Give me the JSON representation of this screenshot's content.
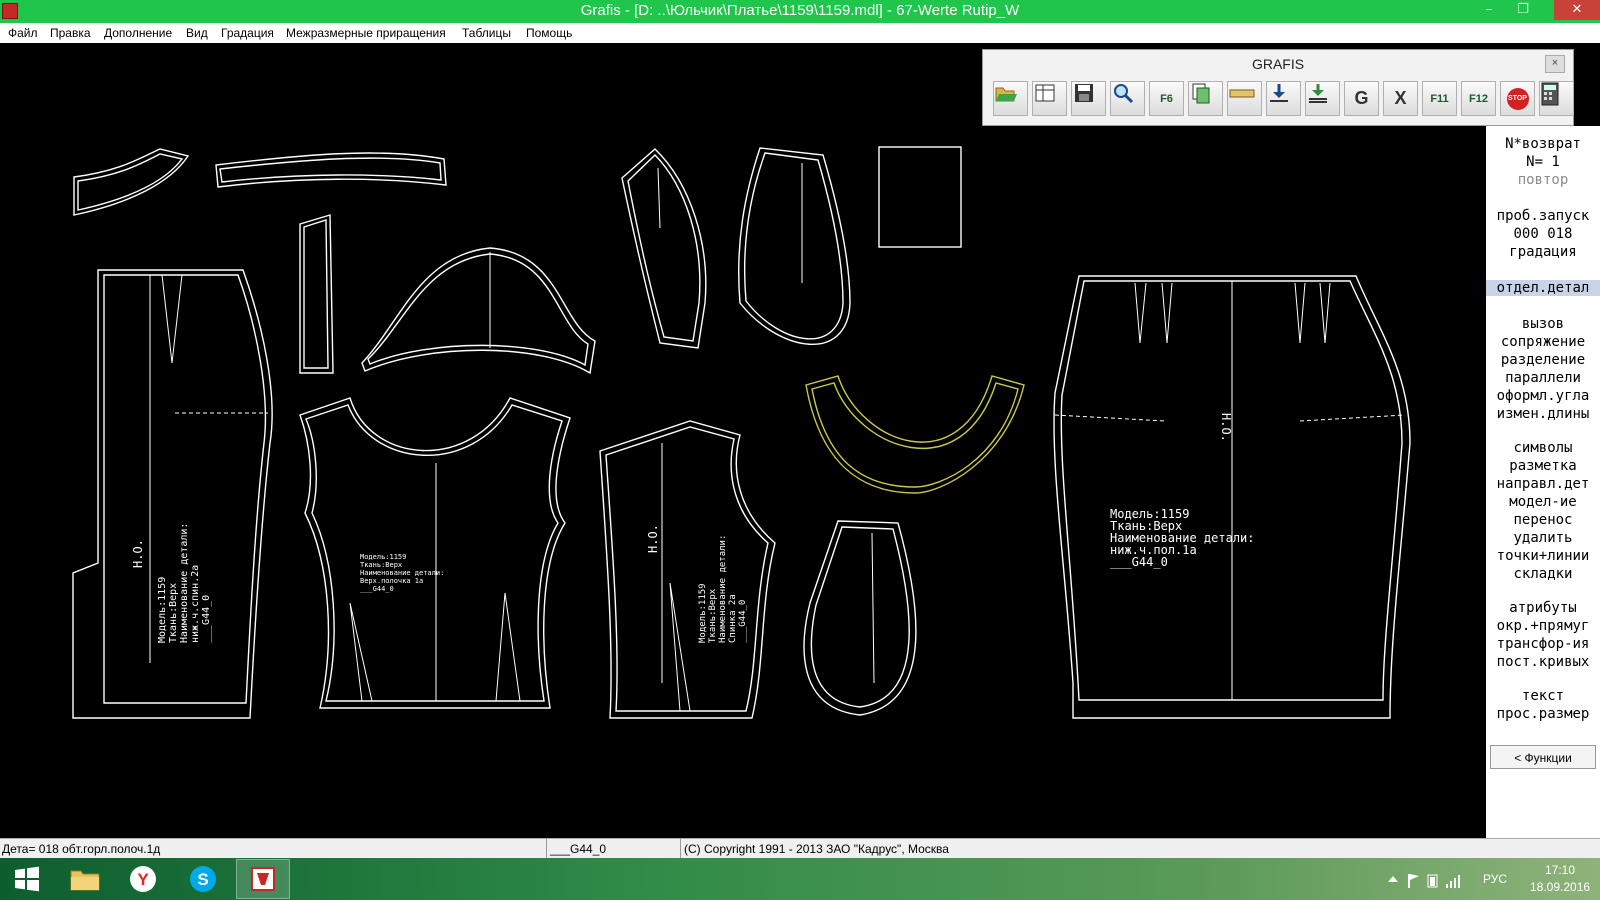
{
  "window": {
    "title": "Grafis - [D: ..\\Юльчик\\Платье\\1159\\1159.mdl] - 67-Werte Rutip_W",
    "controls": {
      "minimize": "–",
      "restore": "❐",
      "close": "✕"
    }
  },
  "menu": [
    "Файл",
    "Правка",
    "Дополнение",
    "Вид",
    "Градация",
    "Межразмерные приращения",
    "Таблицы",
    "Помощь"
  ],
  "toolbar": {
    "title": "GRAFIS",
    "close_label": "×",
    "buttons": [
      {
        "name": "open-icon"
      },
      {
        "name": "table-icon"
      },
      {
        "name": "save-icon"
      },
      {
        "name": "zoom-icon"
      },
      {
        "name": "f6-construct-icon",
        "label": "F6"
      },
      {
        "name": "copy-icon"
      },
      {
        "name": "measure-icon"
      },
      {
        "name": "download-icon"
      },
      {
        "name": "load-all-icon"
      },
      {
        "name": "grafis-g-icon",
        "label": "G"
      },
      {
        "name": "excel-icon",
        "label": "X"
      },
      {
        "name": "f11-icon",
        "label": "F11"
      },
      {
        "name": "f12-icon",
        "label": "F12"
      },
      {
        "name": "stop-icon",
        "label": "STOP"
      },
      {
        "name": "calculator-icon"
      }
    ]
  },
  "side_panel": {
    "return_label": "N*возврат",
    "n_label": "N=  1",
    "repeat_label": "повтор",
    "test_run": "проб.запуск",
    "counter": "000 018",
    "gradation": "градация",
    "selected": "отдел.детал",
    "group1": [
      "вызов",
      "сопряжение",
      "разделение",
      "параллели",
      "оформл.угла",
      "измен.длины"
    ],
    "group2": [
      "символы",
      "разметка",
      "направл.дет",
      "модел-ие",
      "перенос",
      "удалить",
      "точки+линии",
      "складки"
    ],
    "group3": [
      "атрибуты",
      "окр.+прямуг",
      "трансфор-ия",
      "пост.кривых"
    ],
    "group4": [
      "текст",
      "прос.размер"
    ],
    "functions_button": "< Функции"
  },
  "canvas": {
    "piece_skirt_label": [
      "Модель:1159",
      "Ткань:Верх",
      "Наименование детали:",
      "ниж.ч.пол.1а",
      "___G44_0"
    ],
    "piece_front_label": [
      "Модель:1159",
      "Ткань:Верх",
      "Наименование детали:",
      "Верх.полочка 1а",
      "___G44_0"
    ],
    "piece_back_label": [
      "Модель:1159",
      "Ткань:Верх",
      "Наименование детали:",
      "ниж.ч.спин.2а",
      "___G44_0"
    ],
    "piece_back_top_label": [
      "Модель:1159",
      "Ткань:Верх",
      "Наименование детали:",
      "Спинка 2а",
      "___G44_0"
    ],
    "grain_mark": "Н.О."
  },
  "status": {
    "detail": "Дета= 018  обт.горл.полоч.1д",
    "size": "___G44_0",
    "copyright": "(C) Copyright 1991 - 2013 ЗАО \"Кадрус\", Москва"
  },
  "taskbar": {
    "lang": "РУС",
    "time": "17:10",
    "date": "18.09.2016"
  },
  "colors": {
    "titlebar": "#1fc64b",
    "canvas": "#000000",
    "pattern_lines": "#ffffff",
    "selected_piece": "#c9c94a"
  }
}
